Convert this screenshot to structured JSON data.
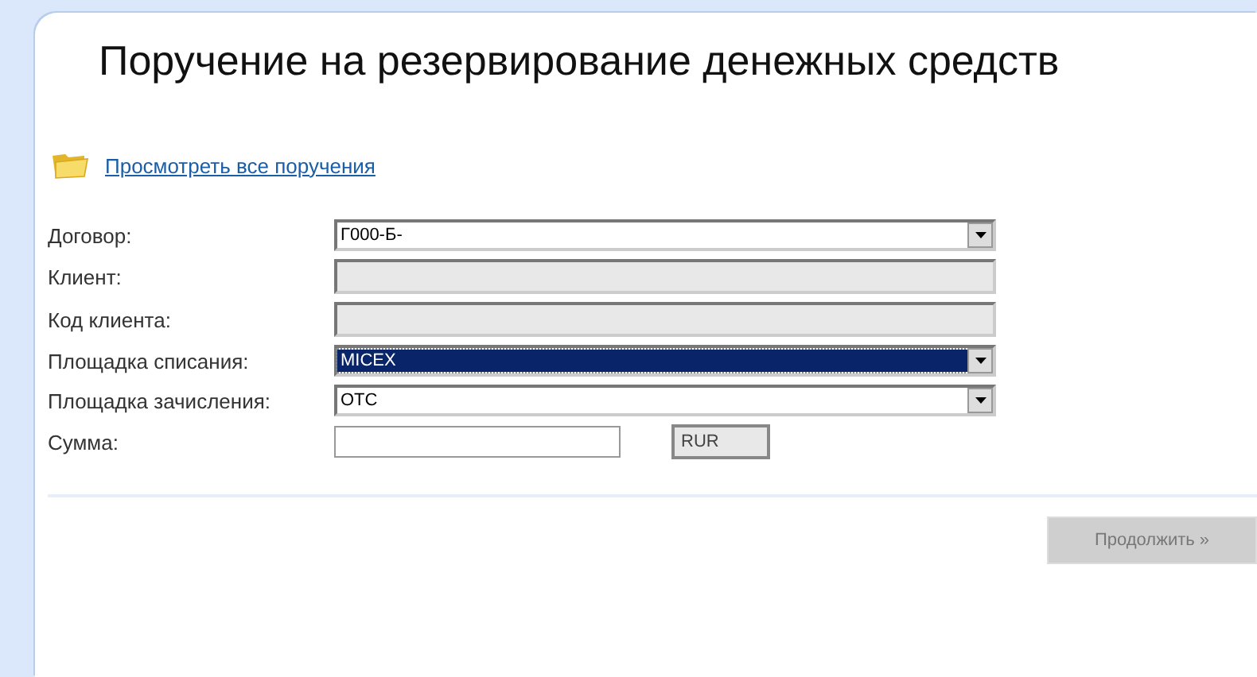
{
  "title": "Поручение на резервирование денежных средств",
  "link": "Просмотреть все поручения",
  "fields": [
    {
      "label": "Договор:",
      "kind": "select",
      "value": "Г000-Б-",
      "focused": false
    },
    {
      "label": "Клиент:",
      "kind": "readonly"
    },
    {
      "label": "Код клиента:",
      "kind": "readonly"
    },
    {
      "label": "Площадка списания:",
      "kind": "select",
      "value": "MICEX",
      "focused": true
    },
    {
      "label": "Площадка зачисления:",
      "kind": "select",
      "value": "OTC",
      "focused": false
    },
    {
      "label": "Сумма:",
      "kind": "amount",
      "currency": "RUR"
    }
  ],
  "submit": {
    "label": "Продолжить »",
    "disabled": true
  }
}
